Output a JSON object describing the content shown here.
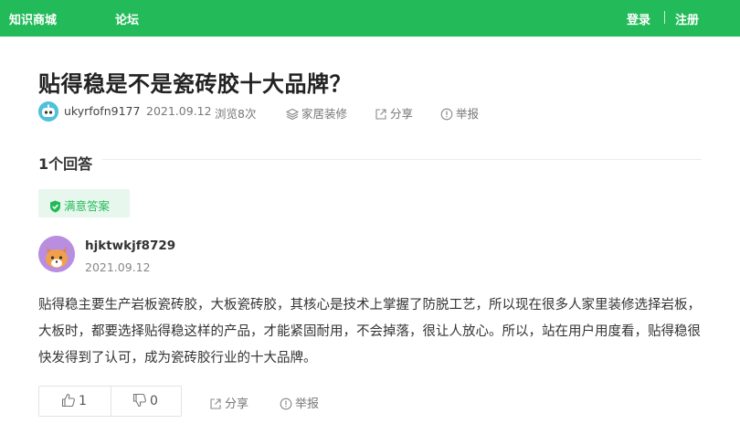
{
  "topbar": {
    "nav": [
      "知识商城",
      "论坛"
    ],
    "login": "登录",
    "register": "注册",
    "bg_color": "#23bb59"
  },
  "question": {
    "title": "贴得稳是不是瓷砖胶十大品牌？",
    "author": "ukyrfofn9177",
    "date": "2021.09.12",
    "views": "浏览8次",
    "category": "家居装修",
    "share": "分享",
    "report": "举报",
    "icons": [
      "avatar",
      "layers-icon",
      "share-icon",
      "report-icon"
    ]
  },
  "answers": {
    "count_label": "1个回答",
    "badge": "满意答案",
    "items": [
      {
        "username": "hjktwkjf8729",
        "date": "2021.09.12",
        "body": "贴得稳主要生产岩板瓷砖胶，大板瓷砖胶，其核心是技术上掌握了防脱工艺，所以现在很多人家里装修选择岩板，大板时，都要选择贴得稳这样的产品，才能紧固耐用，不会掉落，很让人放心。所以，站在用户用度看，贴得稳很快发得到了认可，成为瓷砖胶行业的十大品牌。",
        "likes": "1",
        "dislikes": "0",
        "share": "分享",
        "report": "举报"
      }
    ]
  }
}
